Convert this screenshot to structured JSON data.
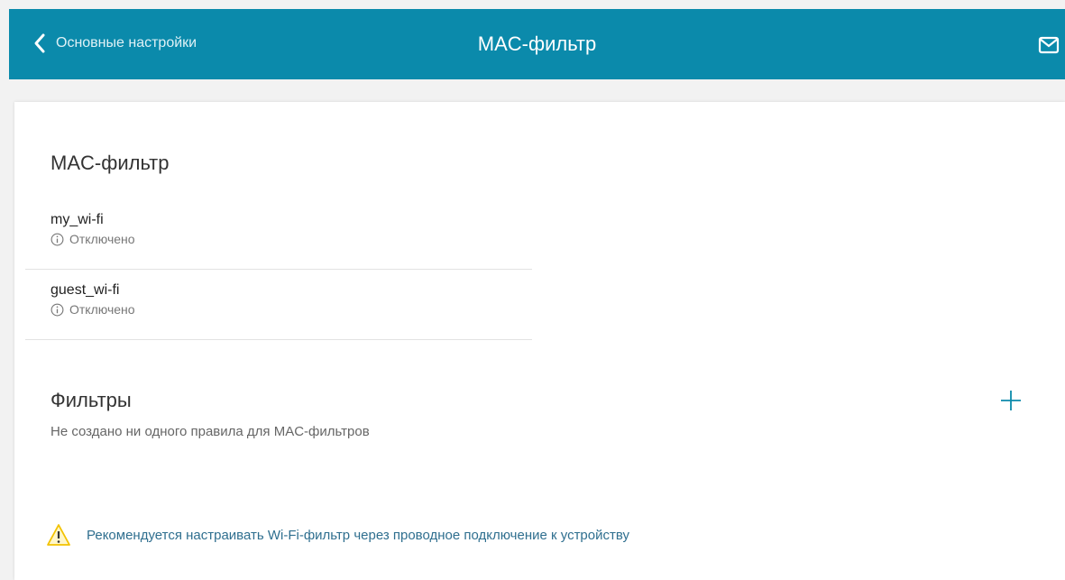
{
  "header": {
    "back_label": "Основные настройки",
    "title": "MAC-фильтр"
  },
  "mac_section": {
    "title": "MAC-фильтр",
    "networks": [
      {
        "name": "my_wi-fi",
        "status": "Отключено"
      },
      {
        "name": "guest_wi-fi",
        "status": "Отключено"
      }
    ]
  },
  "filters": {
    "title": "Фильтры",
    "empty_text": "Не создано ни одного правила для MAC-фильтров"
  },
  "warning": {
    "text": "Рекомендуется настраивать Wi-Fi-фильтр через проводное подключение к устройству"
  },
  "colors": {
    "header_bg": "#0b8aab",
    "warning_icon": "#f2c200",
    "link_text": "#2f6f8f"
  },
  "icons": {
    "back": "chevron-left-icon",
    "mail": "mail-icon",
    "info": "info-icon",
    "add": "plus-icon",
    "warning": "warning-icon"
  }
}
